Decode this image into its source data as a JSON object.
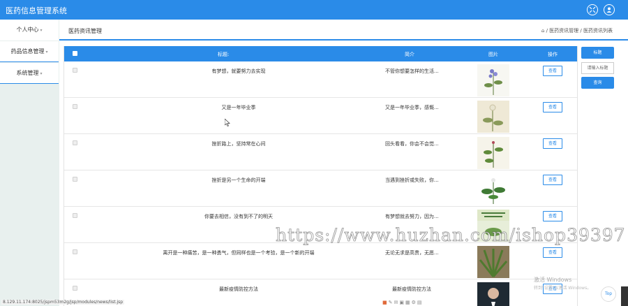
{
  "app": {
    "title": "医药信息管理系统"
  },
  "topbar": {
    "icons": [
      "expand-icon",
      "user-avatar-icon"
    ]
  },
  "sidebar": {
    "items": [
      {
        "label": "个人中心"
      },
      {
        "label": "药品信息管理"
      },
      {
        "label": "系统管理"
      }
    ]
  },
  "header": {
    "page_title": "医药资讯管理",
    "breadcrumb": "/ 医药资讯管理 / 医药资讯列表"
  },
  "table": {
    "columns": {
      "title": "标题:",
      "intro": "简介",
      "image": "图片",
      "action": "操作"
    },
    "view_label": "查看",
    "rows": [
      {
        "title": "有梦想，就要努力去实现",
        "intro": "不管你想要怎样的生活..."
      },
      {
        "title": "又是一年毕业季",
        "intro": "又是一年毕业季，感慨..."
      },
      {
        "title": "挫折路上，坚持常在心间",
        "intro": "回头看看，你会不会觉..."
      },
      {
        "title": "挫折是另一个生命的开端",
        "intro": "当遇到挫折或失败，你..."
      },
      {
        "title": "你要去相信，没有到不了的明天",
        "intro": "有梦想就去努力，因为..."
      },
      {
        "title": "离开是一种痛苦，是一种勇气，但同样也是一个考验，是一个新的开端",
        "intro": "无论无求是高贵，无愿..."
      },
      {
        "title": "最新疫情防控方法",
        "intro": "最新疫情防控方法"
      }
    ]
  },
  "right_panel": {
    "search_button": "标题",
    "input_placeholder": "请输入标题",
    "query_button": "查询"
  },
  "status_bar": {
    "url": "8.129.11.174:8025/jspm53m2g/jsp/modules/news/list.jsp"
  },
  "overlay": {
    "watermark": "https://www.huzhan.com/ishop39397",
    "activate_title": "激活 Windows",
    "activate_sub": "转到\"设置\"以激活 Windows。"
  },
  "top_button": "Top"
}
